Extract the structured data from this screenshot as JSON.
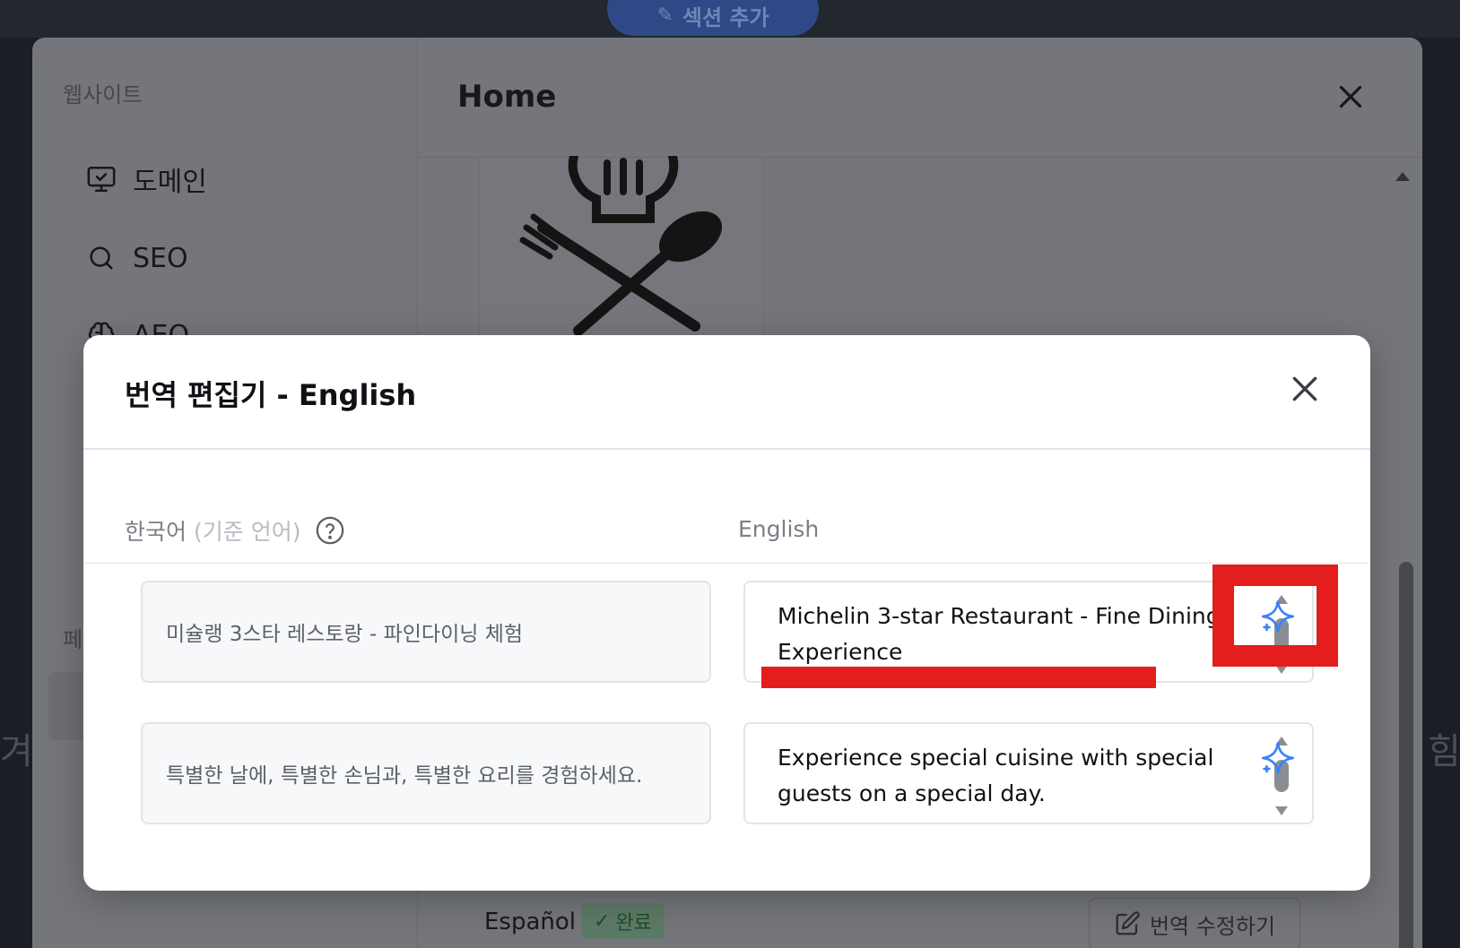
{
  "background": {
    "add_section_label": "섹션 추가",
    "left_edge_text": "겨",
    "right_edge_text": "힘"
  },
  "settings": {
    "sidebar": {
      "section_label": "웹사이트",
      "items": [
        {
          "label": "도메인",
          "icon": "monitor-check-icon"
        },
        {
          "label": "SEO",
          "icon": "search-icon"
        },
        {
          "label": "AEO",
          "icon": "brain-icon"
        }
      ],
      "partial_label": "페"
    },
    "title": "Home",
    "language_row": {
      "language": "Español",
      "status": "완료",
      "edit_button": "번역 수정하기"
    }
  },
  "dialog": {
    "title": "번역 편집기 - English",
    "source_column": "한국어",
    "source_note": "(기준 언어)",
    "target_column": "English",
    "rows": [
      {
        "source": "미슐랭 3스타 레스토랑 - 파인다이닝 체험",
        "target": "Michelin 3-star Restaurant - Fine Dining Experience"
      },
      {
        "source": "특별한 날에, 특별한 손님과, 특별한 요리를 경험하세요.",
        "target": "Experience special cuisine with special guests on a special day."
      }
    ]
  },
  "colors": {
    "annotation": "#e41d1d",
    "ai_icon": "#3b82f6",
    "status_badge": "#1d4f2a"
  }
}
